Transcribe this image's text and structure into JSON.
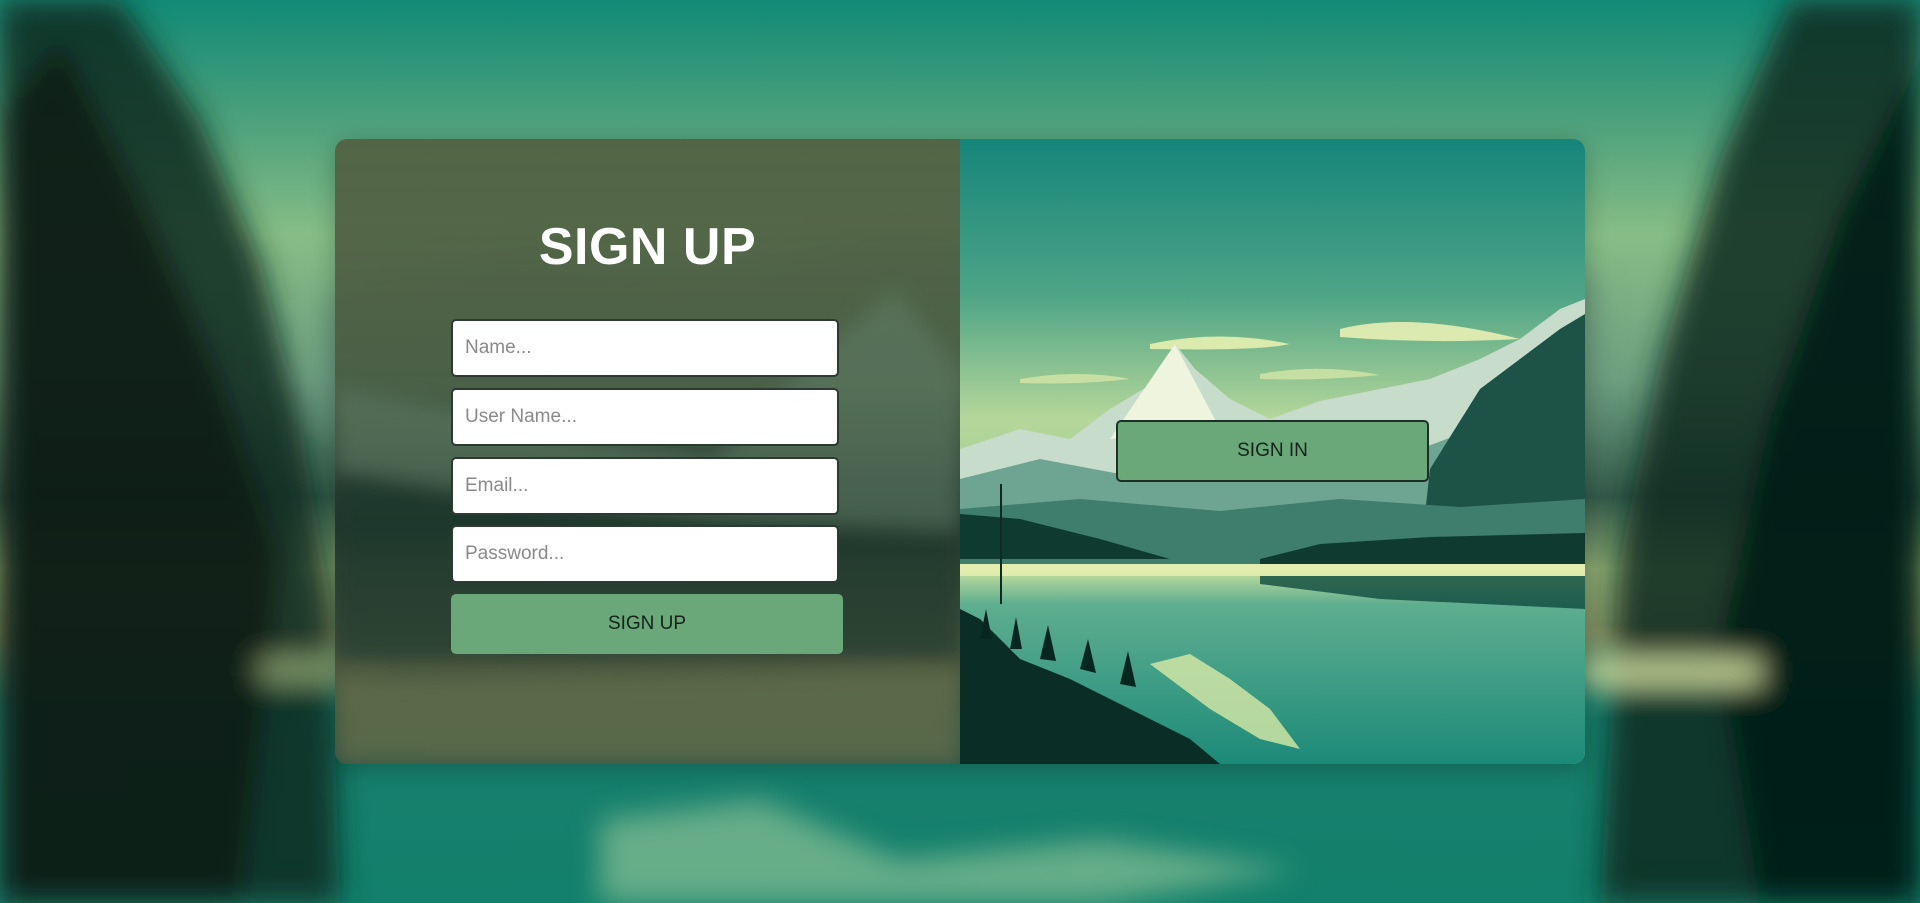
{
  "signup": {
    "title": "SIGN UP",
    "fields": {
      "name_placeholder": "Name...",
      "username_placeholder": "User Name...",
      "email_placeholder": "Email...",
      "password_placeholder": "Password..."
    },
    "submit_label": "SIGN UP"
  },
  "signin": {
    "button_label": "SIGN IN"
  },
  "colors": {
    "button_green": "#6aa87a",
    "title_text": "#ffffff",
    "input_border": "#2d3a33"
  }
}
